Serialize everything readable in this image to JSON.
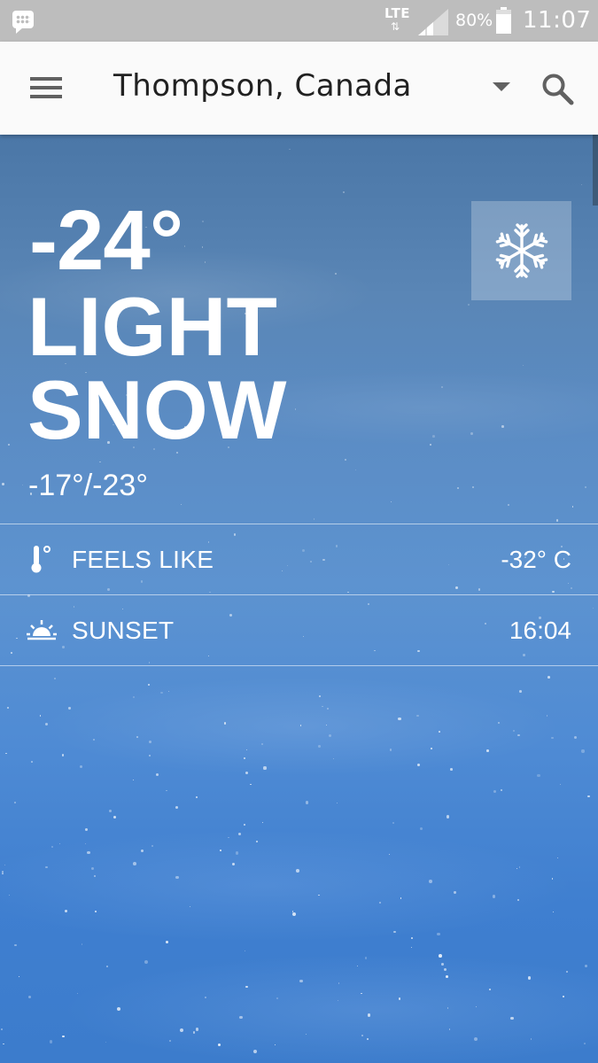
{
  "status_bar": {
    "network": "LTE",
    "network_arrows": "⇅",
    "battery_percent": "80%",
    "time": "11:07"
  },
  "app_bar": {
    "location": "Thompson, Canada",
    "menu_icon": "hamburger-menu-icon",
    "dropdown_icon": "dropdown-arrow-icon",
    "search_icon": "search-icon"
  },
  "current": {
    "temperature": "-24°",
    "condition_line1": "LIGHT",
    "condition_line2": "SNOW",
    "high_low": "-17°/-23°",
    "condition_icon": "snowflake-icon"
  },
  "details": [
    {
      "icon": "thermometer-icon",
      "label": "FEELS LIKE",
      "value": "-32° C"
    },
    {
      "icon": "sunset-icon",
      "label": "SUNSET",
      "value": "16:04"
    }
  ],
  "colors": {
    "status_bar": "#bdbdbd",
    "app_bar": "#fafafa",
    "background": "#4f8bd4",
    "text": "#ffffff"
  }
}
